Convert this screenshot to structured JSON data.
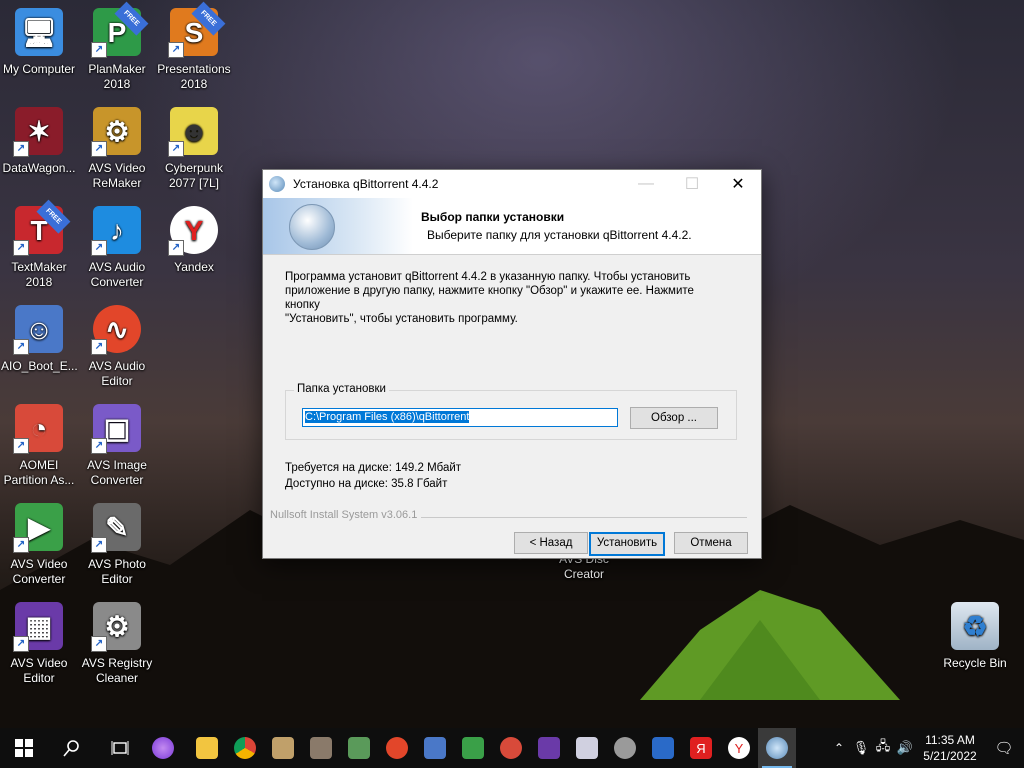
{
  "desktop": {
    "icons": [
      {
        "label": "My Computer",
        "name": "my-computer-icon",
        "color": "#3b8de0",
        "glyph": "🖥"
      },
      {
        "label": "PlanMaker 2018",
        "name": "planmaker-icon",
        "color": "#2e9a48",
        "glyph": "P",
        "badge": "FREE"
      },
      {
        "label": "Presentations 2018",
        "name": "presentations-icon",
        "color": "#e07a1e",
        "glyph": "S",
        "badge": "FREE"
      },
      {
        "label": "DataWagon...",
        "name": "datawagon-icon",
        "color": "#8a1c2a",
        "glyph": "✶"
      },
      {
        "label": "AVS Video ReMaker",
        "name": "avs-video-remaker-icon",
        "color": "#c8952a",
        "glyph": "⚙"
      },
      {
        "label": "Cyberpunk 2077 [7L]",
        "name": "cyberpunk-icon",
        "color": "#e8d54a",
        "glyph": "☻"
      },
      {
        "label": "TextMaker 2018",
        "name": "textmaker-icon",
        "color": "#c8282e",
        "glyph": "T",
        "badge": "FREE"
      },
      {
        "label": "AVS Audio Converter",
        "name": "avs-audio-converter-icon",
        "color": "#1e8ce0",
        "glyph": "♪"
      },
      {
        "label": "Yandex",
        "name": "yandex-icon",
        "color": "#ffffff",
        "glyph": "Y"
      },
      {
        "label": "AIO_Boot_E...",
        "name": "aio-boot-icon",
        "color": "#4a78c8",
        "glyph": "☺"
      },
      {
        "label": "AVS Audio Editor",
        "name": "avs-audio-editor-icon",
        "color": "#e2462a",
        "glyph": "∿"
      },
      {
        "label": "AOMEI Partition As...",
        "name": "aomei-icon",
        "color": "#d84a3a",
        "glyph": "◔"
      },
      {
        "label": "AVS Image Converter",
        "name": "avs-image-converter-icon",
        "color": "#7a5ac8",
        "glyph": "▣"
      },
      {
        "label": "AVS Video Converter",
        "name": "avs-video-converter-icon",
        "color": "#3aa048",
        "glyph": "▶"
      },
      {
        "label": "AVS Photo Editor",
        "name": "avs-photo-editor-icon",
        "color": "#6a6a6a",
        "glyph": "✎"
      },
      {
        "label": "AVS Video Editor",
        "name": "avs-video-editor-icon",
        "color": "#6a3aa8",
        "glyph": "▦"
      },
      {
        "label": "AVS Registry Cleaner",
        "name": "avs-registry-cleaner-icon",
        "color": "#8a8a8a",
        "glyph": "⚙"
      },
      {
        "label": "AVS Disc Creator",
        "name": "avs-disc-creator-icon",
        "color": "#000000",
        "glyph": ""
      },
      {
        "label": "Recycle Bin",
        "name": "recycle-bin-icon",
        "color": "#b8c8d8",
        "glyph": "♻"
      }
    ]
  },
  "dialog": {
    "title": "Установка qBittorrent 4.4.2",
    "header_title": "Выбор папки установки",
    "header_subtitle": "Выберите папку для установки qBittorrent 4.4.2.",
    "intro_line1": "Программа установит qBittorrent 4.4.2 в указанную папку. Чтобы установить",
    "intro_line2": "приложение в другую папку, нажмите кнопку \"Обзор\" и укажите ее. Нажмите кнопку",
    "intro_line3": "\"Установить\", чтобы установить программу.",
    "group_label": "Папка установки",
    "path_value": "C:\\Program Files (x86)\\qBittorrent",
    "browse_label": "Обзор ...",
    "space_required": "Требуется на диске: 149.2 Мбайт",
    "space_available": "Доступно на диске: 35.8 Гбайт",
    "branding": "Nullsoft Install System v3.06.1",
    "back_label": "< Назад",
    "install_label": "Установить",
    "cancel_label": "Отмена"
  },
  "taskbar": {
    "time": "11:35 AM",
    "date": "5/21/2022"
  }
}
